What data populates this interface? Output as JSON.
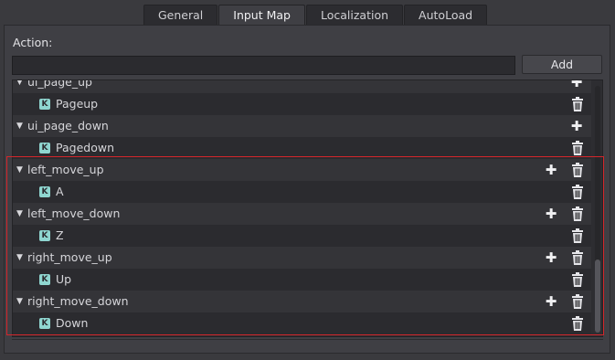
{
  "tabs": [
    {
      "label": "General"
    },
    {
      "label": "Input Map"
    },
    {
      "label": "Localization"
    },
    {
      "label": "AutoLoad"
    }
  ],
  "action_label": "Action:",
  "action_input_value": "",
  "add_label": "Add",
  "rows": [
    {
      "type": "action",
      "name": "ui_page_up",
      "partial": true
    },
    {
      "type": "event",
      "name": "Pageup"
    },
    {
      "type": "action",
      "name": "ui_page_down"
    },
    {
      "type": "event",
      "name": "Pagedown"
    },
    {
      "type": "action",
      "name": "left_move_up"
    },
    {
      "type": "event",
      "name": "A"
    },
    {
      "type": "action",
      "name": "left_move_down"
    },
    {
      "type": "event",
      "name": "Z"
    },
    {
      "type": "action",
      "name": "right_move_up"
    },
    {
      "type": "event",
      "name": "Up"
    },
    {
      "type": "action",
      "name": "right_move_down"
    },
    {
      "type": "event",
      "name": "Down"
    }
  ],
  "icons": {
    "expand": "collapse-arrow-icon",
    "key": "keyboard-key-icon",
    "add": "plus-icon",
    "remove": "trash-icon"
  },
  "colors": {
    "highlight": "#d4262b",
    "key_icon": "#8fd6d0"
  }
}
